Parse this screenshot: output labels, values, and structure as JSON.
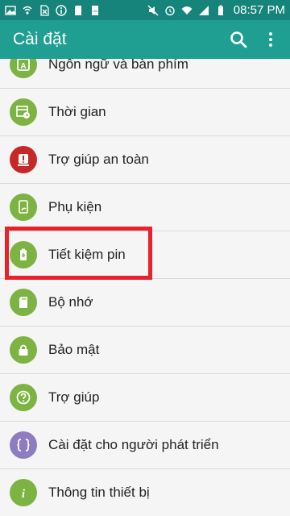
{
  "status_bar": {
    "time": "08:57 PM",
    "icons": [
      "image-icon",
      "wifi-calling-icon",
      "no-sim-icon",
      "info-icon",
      "sd-card-icon",
      "storage-icon",
      "mute-icon",
      "alarm-icon",
      "wifi-icon",
      "signal-icon",
      "battery-icon"
    ]
  },
  "app_bar": {
    "title": "Cài đặt",
    "search_icon": "search-icon",
    "more_icon": "more-vert-icon"
  },
  "settings": [
    {
      "label": "Ngôn ngữ và bàn phím",
      "icon": "language-icon",
      "color": "#7cb342"
    },
    {
      "label": "Thời gian",
      "icon": "calendar-clock-icon",
      "color": "#7cb342"
    },
    {
      "label": "Trợ giúp an toàn",
      "icon": "alert-icon",
      "color": "#c62828"
    },
    {
      "label": "Phụ kiện",
      "icon": "accessory-icon",
      "color": "#7cb342"
    },
    {
      "label": "Tiết kiệm pin",
      "icon": "battery-saver-icon",
      "color": "#7cb342"
    },
    {
      "label": "Bộ nhớ",
      "icon": "sd-card-icon",
      "color": "#7cb342"
    },
    {
      "label": "Bảo mật",
      "icon": "lock-icon",
      "color": "#7cb342"
    },
    {
      "label": "Trợ giúp",
      "icon": "help-icon",
      "color": "#7cb342"
    },
    {
      "label": "Cài đặt cho người phát triển",
      "icon": "developer-icon",
      "color": "#8e7cc3"
    },
    {
      "label": "Thông tin thiết bị",
      "icon": "info-icon",
      "color": "#7cb342"
    }
  ],
  "colors": {
    "status_bar": "#16847a",
    "app_bar": "#1e9f91",
    "highlight": "#e8212a"
  }
}
